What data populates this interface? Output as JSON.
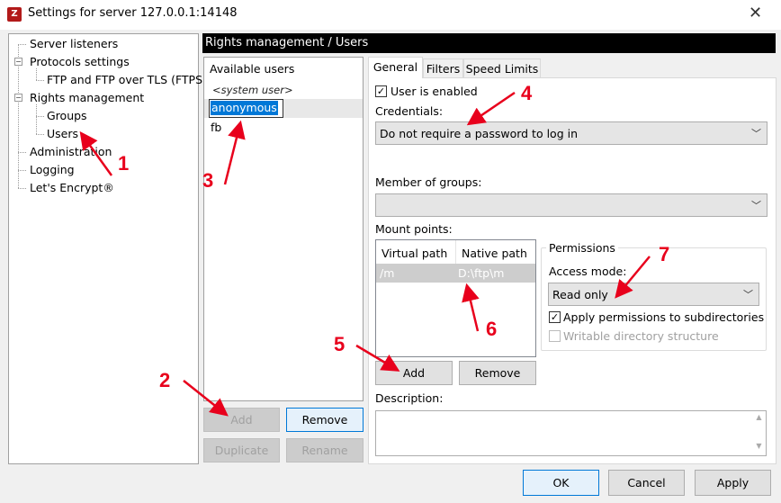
{
  "window": {
    "app_icon_text": "Z",
    "title": "Settings for server 127.0.0.1:14148",
    "close_glyph": "✕"
  },
  "tree": {
    "items": [
      {
        "label": "Server listeners"
      },
      {
        "label": "Protocols settings"
      },
      {
        "label": "FTP and FTP over TLS (FTPS)"
      },
      {
        "label": "Rights management"
      },
      {
        "label": "Groups"
      },
      {
        "label": "Users"
      },
      {
        "label": "Administration"
      },
      {
        "label": "Logging"
      },
      {
        "label": "Let's Encrypt®"
      }
    ]
  },
  "header": {
    "title": "Rights management / Users"
  },
  "users": {
    "title": "Available users",
    "system_user": "<system user>",
    "editing_value": "anonymous",
    "other_user": "fb",
    "buttons": {
      "add": "Add",
      "remove": "Remove",
      "duplicate": "Duplicate",
      "rename": "Rename"
    }
  },
  "tabs": [
    {
      "label": "General",
      "active": true
    },
    {
      "label": "Filters",
      "active": false
    },
    {
      "label": "Speed Limits",
      "active": false
    }
  ],
  "general": {
    "user_enabled_label": "User is enabled",
    "user_enabled_checked": true,
    "credentials_label": "Credentials:",
    "credentials_value": "Do not require a password to log in",
    "member_groups_label": "Member of groups:",
    "member_groups_value": "",
    "mount_points_label": "Mount points:",
    "mount_points": {
      "columns": [
        "Virtual path",
        "Native path"
      ],
      "rows": [
        {
          "virtual": "/m",
          "native": "D:\\ftp\\m"
        }
      ]
    },
    "mp_buttons": {
      "add": "Add",
      "remove": "Remove"
    },
    "permissions": {
      "title": "Permissions",
      "access_mode_label": "Access mode:",
      "access_mode_value": "Read only",
      "apply_subdirs_label": "Apply permissions to subdirectories",
      "apply_subdirs_checked": true,
      "writable_label": "Writable directory structure",
      "writable_checked": false
    },
    "description_label": "Description:",
    "description_value": ""
  },
  "dialog_buttons": {
    "ok": "OK",
    "cancel": "Cancel",
    "apply": "Apply"
  },
  "annotations": {
    "color": "#e8001c",
    "labels": [
      "1",
      "2",
      "3",
      "4",
      "5",
      "6",
      "7"
    ]
  },
  "colors": {
    "selection": "#0078d7",
    "header_bg": "#000000",
    "annotation": "#e8001c"
  }
}
